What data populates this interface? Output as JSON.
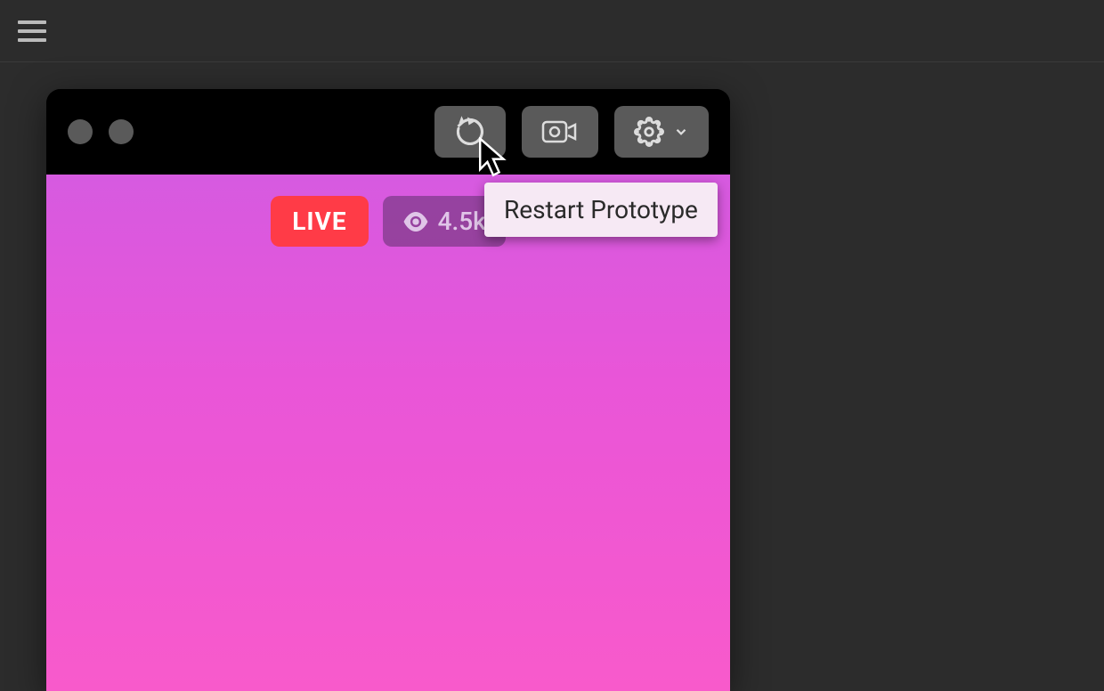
{
  "topbar": {
    "menu_icon": "hamburger-icon"
  },
  "prototype": {
    "toolbar": {
      "restart_icon": "restart-icon",
      "camera_icon": "camera-icon",
      "settings_icon": "gear-icon",
      "chevron_icon": "chevron-down-icon"
    },
    "content": {
      "live_label": "LIVE",
      "viewer_count": "4.5k",
      "eye_icon": "eye-icon"
    }
  },
  "tooltip": {
    "text": "Restart Prototype"
  },
  "colors": {
    "live_badge": "#ff3b47",
    "gradient_top": "#d65ae0",
    "gradient_bottom": "#f85acb",
    "tooltip_bg": "#f6e9f4"
  }
}
